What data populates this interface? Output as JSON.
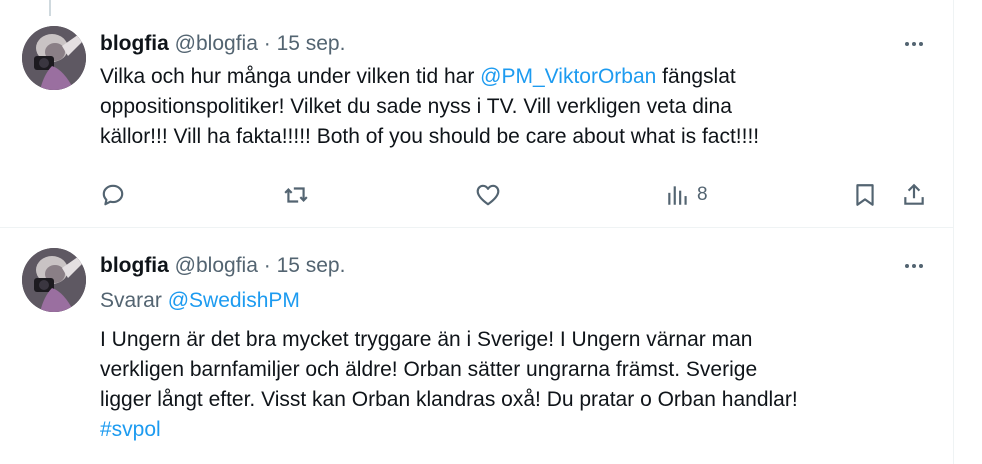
{
  "tweets": [
    {
      "author_name": "blogfia",
      "author_handle": "@blogfia",
      "separator": "·",
      "date": "15 sep.",
      "lines": [
        {
          "pre": "Vilka och hur många under vilken tid har ",
          "mention": "@PM_ViktorOrban",
          "post": " fängslat"
        },
        "oppositionspolitiker! Vilket du sade nyss i TV. Vill verkligen veta dina",
        "källor!!!  Vill ha fakta!!!!! Both of you should be care about what is fact!!!!"
      ],
      "views": "8"
    },
    {
      "author_name": "blogfia",
      "author_handle": "@blogfia",
      "separator": "·",
      "date": "15 sep.",
      "reply_prefix": "Svarar",
      "reply_handle": "@SwedishPM",
      "lines": [
        "I Ungern är det bra mycket tryggare än i Sverige! I Ungern värnar man",
        "verkligen barnfamiljer och äldre! Orban sätter ungrarna främst. Sverige",
        "ligger långt efter. Visst kan Orban klandras oxå! Du pratar o Orban handlar!"
      ],
      "hashtag": "#svpol"
    }
  ],
  "icons": {
    "more": "more-horizontal-icon",
    "reply": "reply-icon",
    "retweet": "retweet-icon",
    "like": "like-icon",
    "views": "views-icon",
    "bookmark": "bookmark-icon",
    "share": "share-icon"
  },
  "colors": {
    "accent": "#1d9bf0",
    "text": "#0f1419",
    "muted": "#536471",
    "border": "#eff3f4"
  }
}
